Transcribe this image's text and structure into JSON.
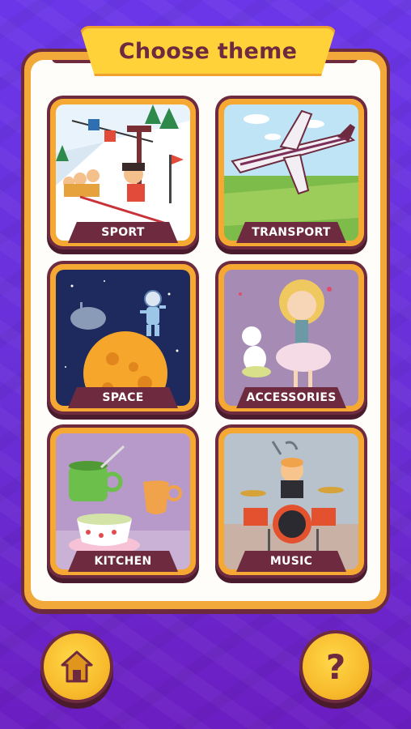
{
  "header": {
    "title": "Choose theme"
  },
  "themes": [
    {
      "label": "SPORT"
    },
    {
      "label": "TRANSPORT"
    },
    {
      "label": "SPACE"
    },
    {
      "label": "ACCESSORIES"
    },
    {
      "label": "KITCHEN"
    },
    {
      "label": "MUSIC"
    }
  ],
  "footer": {
    "home_icon": "home-icon",
    "help_glyph": "?"
  },
  "colors": {
    "background": "#6a2fd7",
    "board": "#f2a93a",
    "accent_dark": "#6e2b40",
    "banner": "#ffd23a"
  }
}
